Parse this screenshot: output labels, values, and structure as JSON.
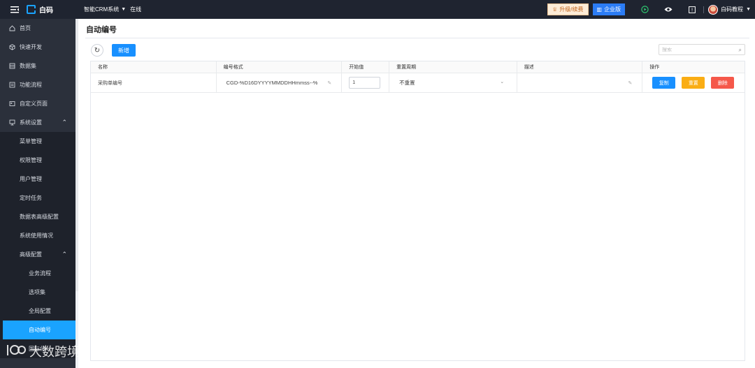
{
  "topbar": {
    "logo_text": "白码",
    "system_name": "智能CRM系统",
    "status": "在线",
    "upgrade_label": "升级/续费",
    "enterprise_label": "企业版",
    "user_name": "白码教程"
  },
  "sidebar": {
    "items": [
      {
        "label": "首页",
        "icon": "home-icon"
      },
      {
        "label": "快速开发",
        "icon": "cube-icon"
      },
      {
        "label": "数据集",
        "icon": "database-icon"
      },
      {
        "label": "功能流程",
        "icon": "flow-icon"
      },
      {
        "label": "自定义页面",
        "icon": "page-icon"
      },
      {
        "label": "系统设置",
        "icon": "monitor-icon"
      }
    ],
    "settings_children": [
      "菜单管理",
      "权限管理",
      "用户管理",
      "定时任务",
      "数据表高级配置",
      "系统使用情况",
      "高级配置"
    ],
    "advanced_children": [
      "业务流程",
      "选项集",
      "全局配置",
      "自动编号"
    ],
    "trailing": [
      "国际化"
    ]
  },
  "page": {
    "title": "自动编号",
    "new_button": "新增",
    "search_placeholder": "搜索"
  },
  "table": {
    "headers": [
      "名称",
      "编号格式",
      "开始值",
      "重置周期",
      "描述",
      "操作"
    ],
    "rows": [
      {
        "name": "采购单编号",
        "format": "CGD-%D16DYYYYMMDDHHmmss--%",
        "start": "1",
        "reset": "不重置",
        "description": "",
        "actions": [
          "复制",
          "重置",
          "删除"
        ]
      }
    ]
  },
  "watermark": {
    "text": "大数跨境"
  }
}
